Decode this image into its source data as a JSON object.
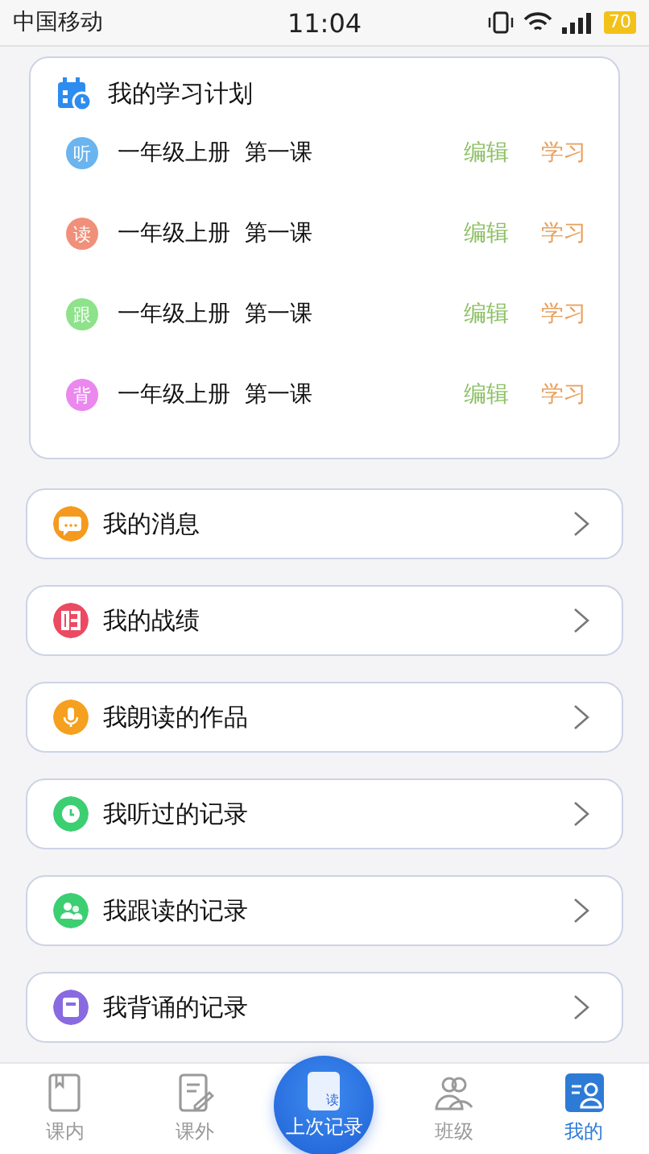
{
  "status_bar": {
    "carrier": "中国移动",
    "time": "11:04",
    "battery": "70"
  },
  "plan": {
    "title": "我的学习计划",
    "rows": [
      {
        "badge": "听",
        "color": "#6ab4f0",
        "lesson": "一年级上册  第一课",
        "edit": "编辑",
        "study": "学习"
      },
      {
        "badge": "读",
        "color": "#f0907a",
        "lesson": "一年级上册  第一课",
        "edit": "编辑",
        "study": "学习"
      },
      {
        "badge": "跟",
        "color": "#8ee28a",
        "lesson": "一年级上册  第一课",
        "edit": "编辑",
        "study": "学习"
      },
      {
        "badge": "背",
        "color": "#ea88ee",
        "lesson": "一年级上册  第一课",
        "edit": "编辑",
        "study": "学习"
      }
    ]
  },
  "menu": [
    {
      "label": "我的消息",
      "kind": "chat",
      "color": "#f59a1e"
    },
    {
      "label": "我的战绩",
      "kind": "score",
      "color": "#ec4a62"
    },
    {
      "label": "我朗读的作品",
      "kind": "mic",
      "color": "#f5a01e"
    },
    {
      "label": "我听过的记录",
      "kind": "clock",
      "color": "#3ccf72"
    },
    {
      "label": "我跟读的记录",
      "kind": "people",
      "color": "#3ccf72"
    },
    {
      "label": "我背诵的记录",
      "kind": "book",
      "color": "#8a6ae0"
    }
  ],
  "tabs": [
    {
      "label": "课内",
      "kind": "book",
      "selected": false
    },
    {
      "label": "课外",
      "kind": "note",
      "selected": false
    },
    {
      "label": "上次记录",
      "kind": "center",
      "icon_text": "读",
      "selected": false
    },
    {
      "label": "班级",
      "kind": "people",
      "selected": false
    },
    {
      "label": "我的",
      "kind": "profile",
      "selected": true
    }
  ]
}
